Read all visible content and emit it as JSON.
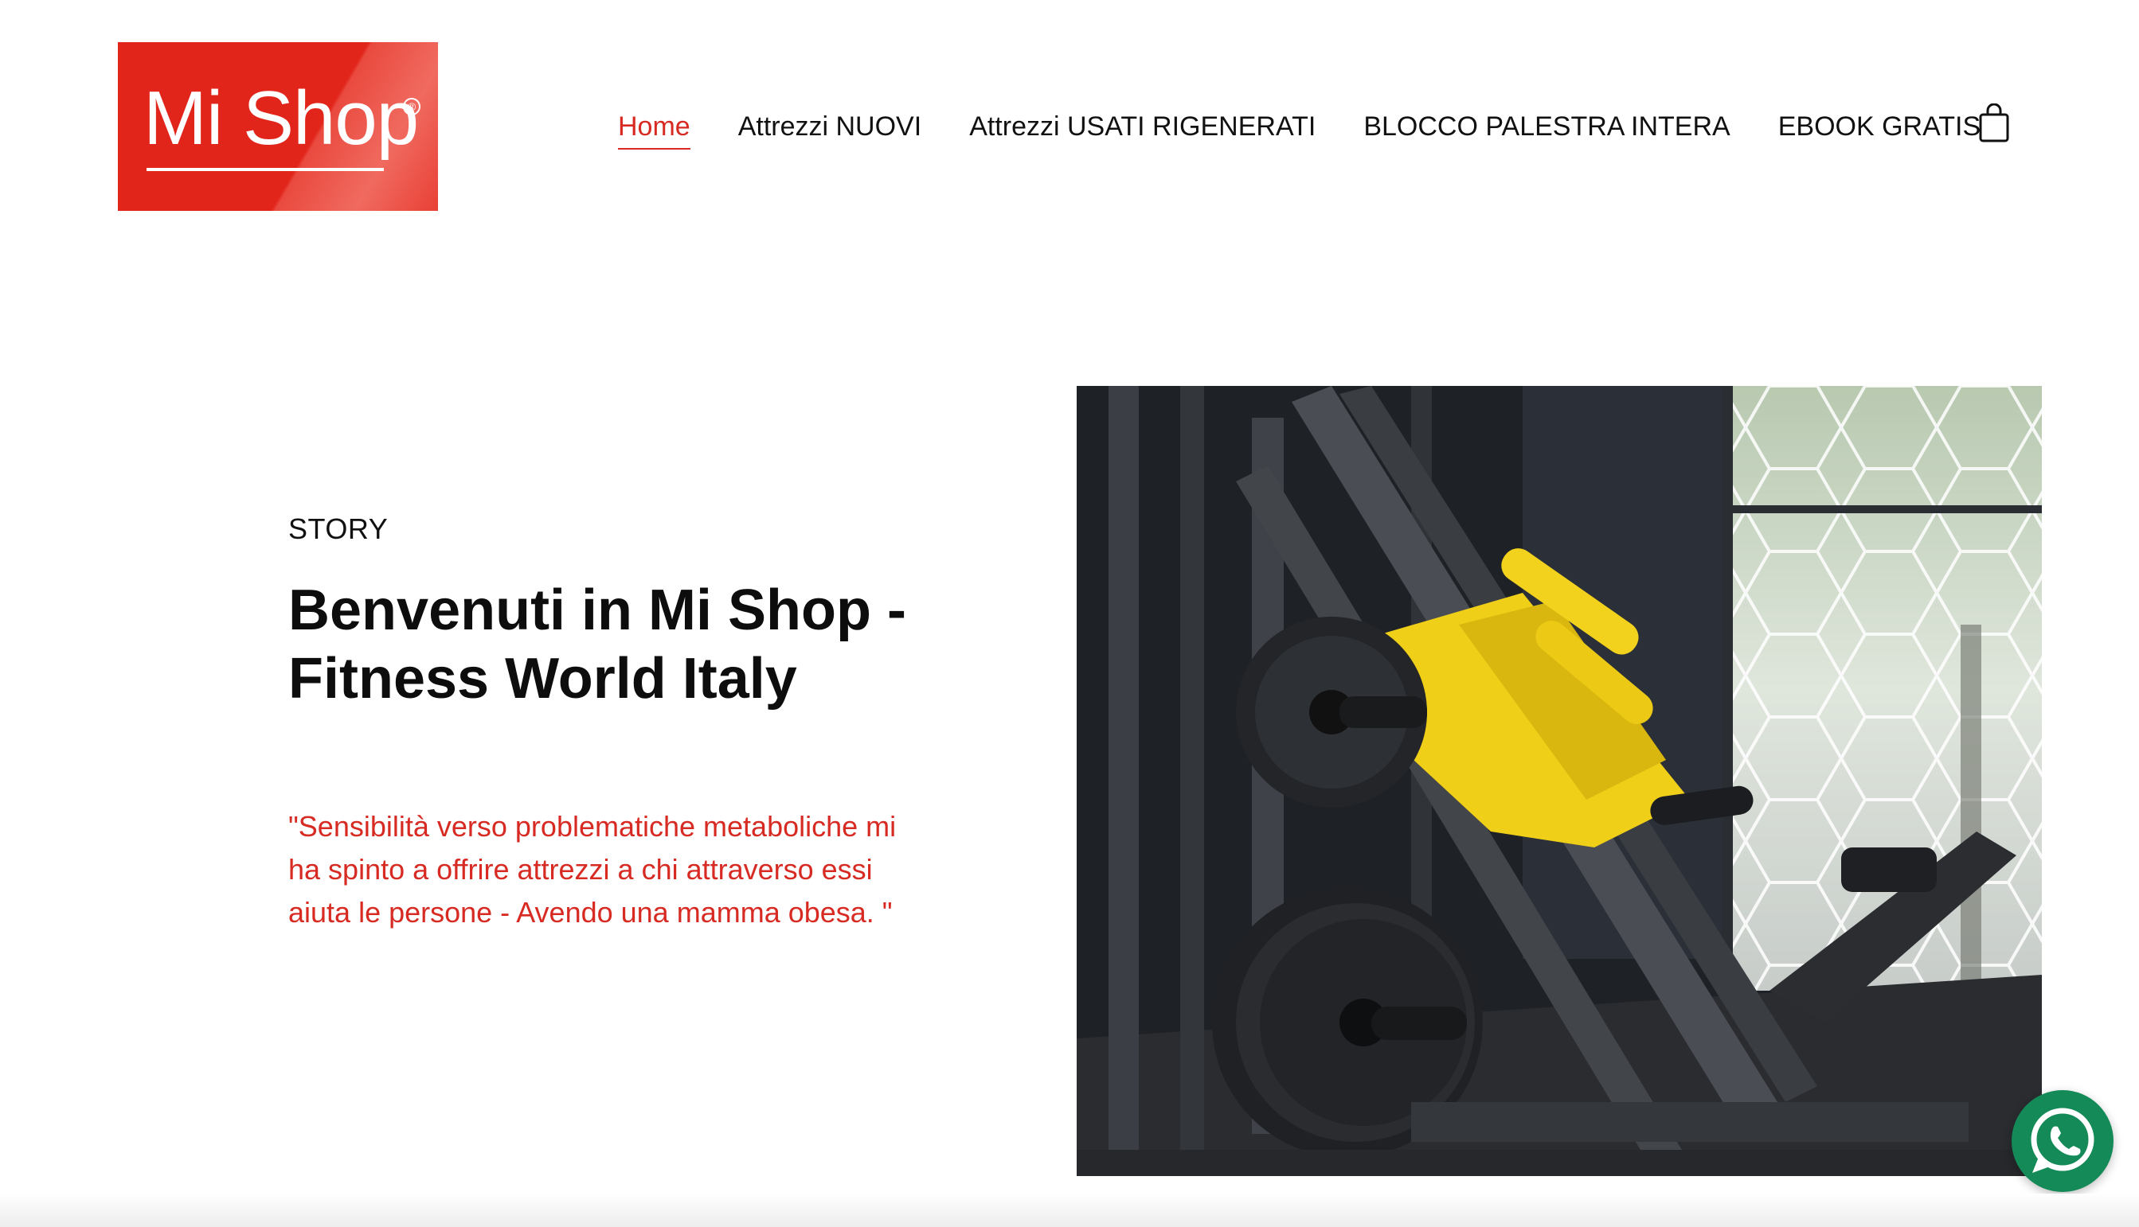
{
  "header": {
    "logo_text": "Mi Shop",
    "logo_reg": "®",
    "nav": [
      {
        "label": "Home",
        "active": true
      },
      {
        "label": "Attrezzi NUOVI",
        "active": false
      },
      {
        "label": "Attrezzi USATI RIGENERATI",
        "active": false
      },
      {
        "label": "BLOCCO PALESTRA INTERA",
        "active": false
      },
      {
        "label": "EBOOK GRATIS",
        "active": false
      }
    ],
    "cart_icon": "shopping-bag-icon"
  },
  "hero": {
    "eyebrow": "STORY",
    "title": "Benvenuti in Mi Shop - Fitness World Italy",
    "quote": "\"Sensibilità verso problematiche metaboliche mi ha spinto a offrire attrezzi a chi attraverso essi aiuta le persone - Avendo una mamma obesa. \"",
    "image": "gym-leg-press-machine-photo"
  },
  "colors": {
    "brand_red": "#e1251b",
    "accent_red": "#d72a22",
    "whatsapp_green": "#148a58"
  },
  "floating": {
    "whatsapp_icon": "whatsapp-icon"
  }
}
